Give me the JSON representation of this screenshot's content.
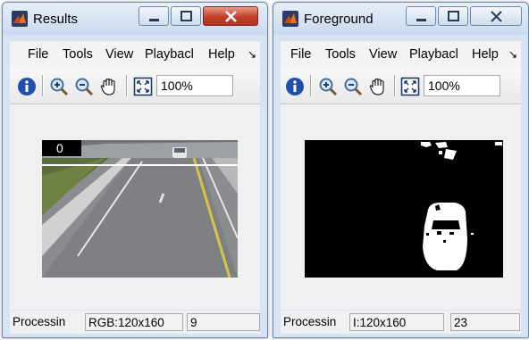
{
  "windows": [
    {
      "title": "Results",
      "menu": [
        "File",
        "Tools",
        "View",
        "Playbacl",
        "Help"
      ],
      "zoom": "100%",
      "frame_label": "0",
      "status": {
        "label": "Processin",
        "format": "RGB:120x160",
        "value": "9"
      }
    },
    {
      "title": "Foreground",
      "menu": [
        "File",
        "Tools",
        "View",
        "Playbacl",
        "Help"
      ],
      "zoom": "100%",
      "status": {
        "label": "Processin",
        "format": "I:120x160",
        "value": "23"
      }
    }
  ],
  "icons": {
    "app": "matlab-icon",
    "minimize": "minimize-icon",
    "maximize": "maximize-icon",
    "close": "close-icon",
    "info": "info-icon",
    "zoom_in": "zoom-in-icon",
    "zoom_out": "zoom-out-icon",
    "pan": "pan-hand-icon",
    "fit": "fit-to-window-icon",
    "menu_overflow": "menu-overflow-icon"
  },
  "colors": {
    "close_button": "#c2402a",
    "frame_chrome": "#d5e3f3",
    "info_icon": "#1f4fa8"
  }
}
